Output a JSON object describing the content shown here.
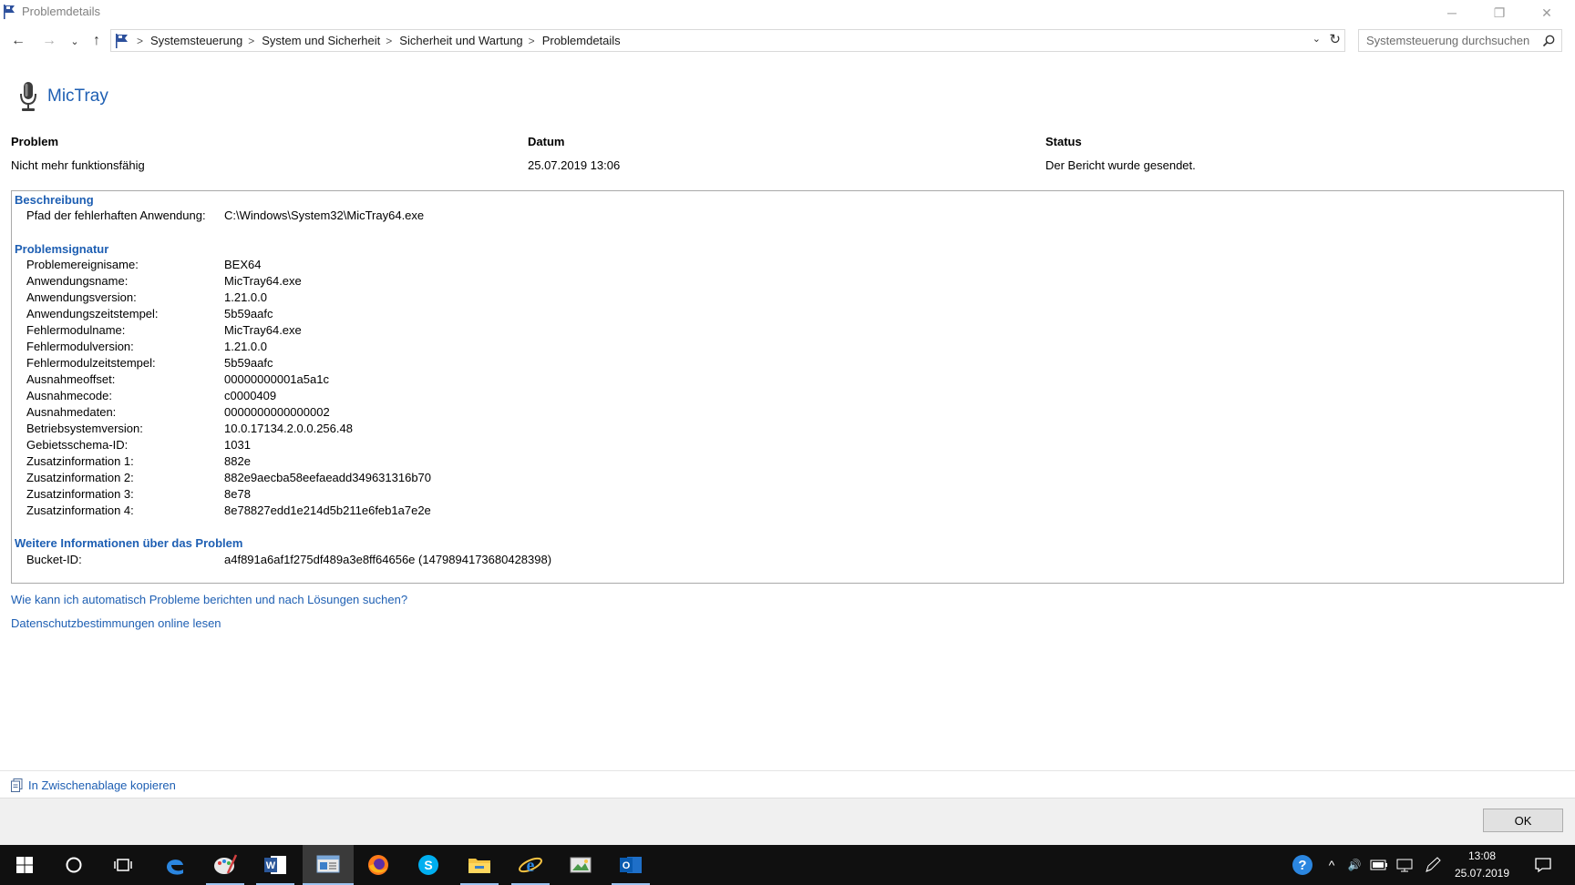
{
  "window": {
    "title": "Problemdetails",
    "minimize_glyph": "─",
    "maximize_glyph": "❐",
    "close_glyph": "✕"
  },
  "nav": {
    "back_glyph": "←",
    "forward_glyph": "→",
    "recent_glyph": "⌄",
    "up_glyph": "↑",
    "breadcrumbs": [
      "Systemsteuerung",
      "System und Sicherheit",
      "Sicherheit und Wartung",
      "Problemdetails"
    ],
    "separator": ">",
    "dropdown_glyph": "⌄",
    "refresh_glyph": "↻",
    "search_placeholder": "Systemsteuerung durchsuchen"
  },
  "app": {
    "name": "MicTray"
  },
  "summary": {
    "problem_header": "Problem",
    "problem_value": "Nicht mehr funktionsfähig",
    "date_header": "Datum",
    "date_value": "25.07.2019 13:06",
    "status_header": "Status",
    "status_value": "Der Bericht wurde gesendet."
  },
  "description": {
    "title": "Beschreibung",
    "rows": [
      {
        "key": "Pfad der fehlerhaften Anwendung:",
        "value": "C:\\Windows\\System32\\MicTray64.exe"
      }
    ]
  },
  "signature": {
    "title": "Problemsignatur",
    "rows": [
      {
        "key": "Problemereignisame:",
        "value": "BEX64"
      },
      {
        "key": "Anwendungsname:",
        "value": "MicTray64.exe"
      },
      {
        "key": "Anwendungsversion:",
        "value": "1.21.0.0"
      },
      {
        "key": "Anwendungszeitstempel:",
        "value": "5b59aafc"
      },
      {
        "key": "Fehlermodulname:",
        "value": "MicTray64.exe"
      },
      {
        "key": "Fehlermodulversion:",
        "value": "1.21.0.0"
      },
      {
        "key": "Fehlermodulzeitstempel:",
        "value": "5b59aafc"
      },
      {
        "key": "Ausnahmeoffset:",
        "value": "00000000001a5a1c"
      },
      {
        "key": "Ausnahmecode:",
        "value": "c0000409"
      },
      {
        "key": "Ausnahmedaten:",
        "value": "0000000000000002"
      },
      {
        "key": "Betriebsystemversion:",
        "value": "10.0.17134.2.0.0.256.48"
      },
      {
        "key": "Gebietsschema-ID:",
        "value": "1031"
      },
      {
        "key": "Zusatzinformation 1:",
        "value": "882e"
      },
      {
        "key": "Zusatzinformation 2:",
        "value": "882e9aecba58eefaeadd349631316b70"
      },
      {
        "key": "Zusatzinformation 3:",
        "value": "8e78"
      },
      {
        "key": "Zusatzinformation 4:",
        "value": "8e78827edd1e214d5b211e6feb1a7e2e"
      }
    ]
  },
  "more_info": {
    "title": "Weitere Informationen über das Problem",
    "rows": [
      {
        "key": "Bucket-ID:",
        "value": "a4f891a6af1f275df489a3e8ff64656e (1479894173680428398)"
      }
    ]
  },
  "links": {
    "report": "Wie kann ich automatisch Probleme berichten und nach Lösungen suchen?",
    "privacy": "Datenschutzbestimmungen online lesen"
  },
  "footer": {
    "copy_label": "In Zwischenablage kopieren",
    "ok_label": "OK"
  },
  "taskbar": {
    "clock_time": "13:08",
    "clock_date": "25.07.2019",
    "help_glyph": "?",
    "tray_chevron": "^",
    "volume_glyph": "🔊"
  },
  "colors": {
    "accent": "#1e5fb3",
    "taskbar": "#101010"
  }
}
